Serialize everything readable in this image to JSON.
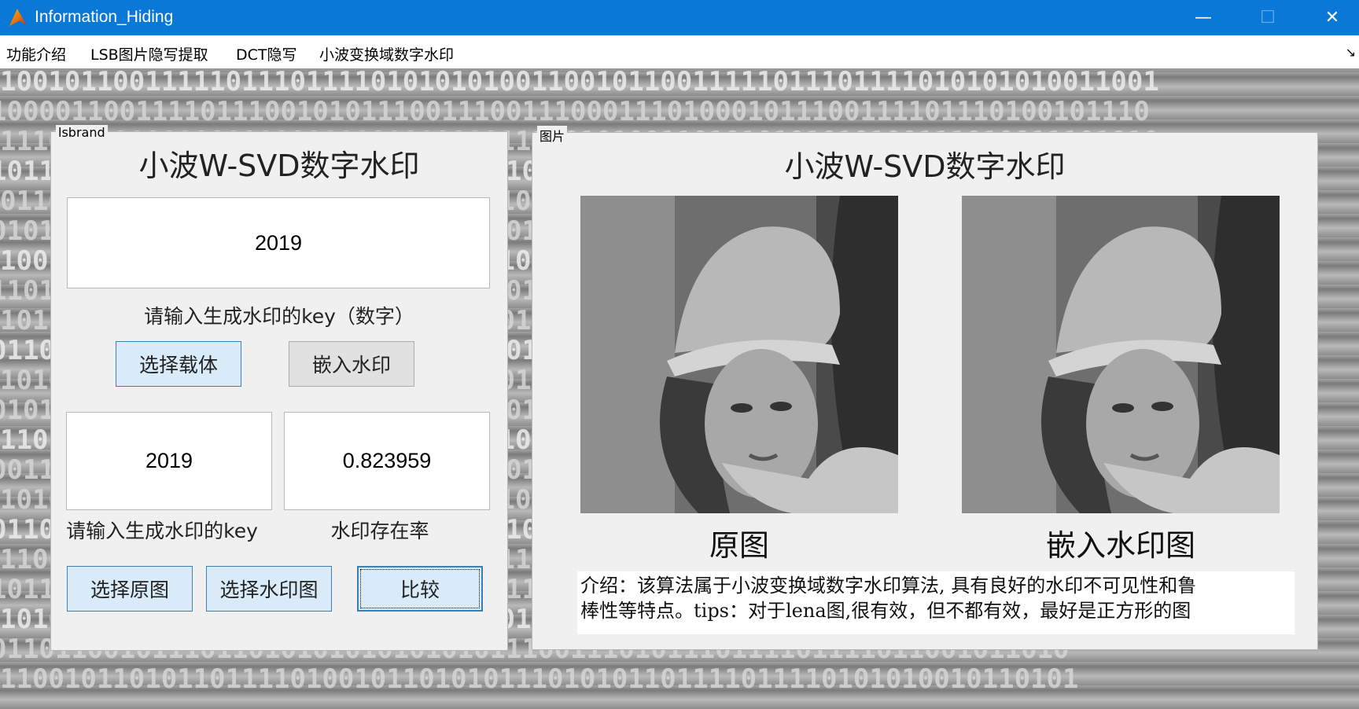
{
  "window": {
    "title": "Information_Hiding",
    "controls": {
      "minimize": "—",
      "maximize": "☐",
      "close": "✕"
    }
  },
  "menu": {
    "items": [
      "功能介绍",
      "LSB图片隐写提取",
      "DCT隐写",
      "小波变换域数字水印"
    ],
    "overflow_icon": "↘"
  },
  "background": {
    "binary_rows": [
      "100101100111110111011110101010100110010110011111011101111010101010011001",
      "100001100111101110010101110011100111000111010001011100111101110100101110",
      "111011101011001010011110101001011110101001101010101010100111010011101010",
      "10110011001101111000101101001110101101001011010110011010010111001101",
      "01101001011001101101011010110101001101100111010110010110101101101010",
      "01011010011010110010110110101011010100101101011001011010110101101011",
      "10010110110010101101001011011011010110101001010101101010110110010110",
      "11010011011010010110101100101011010101101011010101101011010100101101",
      "10110101001011010110101101010010110101011010110101001011010110101101",
      "01101011011010101001011010110101011010101101001010110101101010110101",
      "10101101001101011010101101011010100101101011010110101001011010110110",
      "01011010110101011010110100101101011010110101011010101101001011010101",
      "11010110101101010010110101101011010100101101011010110101011010101101",
      "00110101101011010110100101101011010101101011010010110101101010110100",
      "10101100101011010110101101001011010110101011010101101001011010110101",
      "01101011010110101001011010110101101010110100101101011010101101011010",
      "11001011010110101101010110100101101011010110101010110101101001010110",
      "10110101101001011010110101011010110101001011010110101101010110101001",
      "101011010110100010110110101010101100111100110111101011010101010101",
      "0110110010111011010101010101010111001110101110111101111011001011010",
      "1100101101011011110100101101010111010101101111011110101010010110101"
    ]
  },
  "left_panel": {
    "legend": "lsbrand",
    "heading": "小波W-SVD数字水印",
    "key_input_value": "2019",
    "key_input_label": "请输入生成水印的key（数字）",
    "btn_select_carrier": "选择载体",
    "btn_embed": "嵌入水印",
    "key2_value": "2019",
    "rate_value": "0.823959",
    "key2_label": "请输入生成水印的key",
    "rate_label": "水印存在率",
    "btn_select_original": "选择原图",
    "btn_select_watermark": "选择水印图",
    "btn_compare": "比较"
  },
  "right_panel": {
    "legend": "图片",
    "heading": "小波W-SVD数字水印",
    "caption_original": "原图",
    "caption_watermarked": "嵌入水印图",
    "intro_line1": "介绍：该算法属于小波变换域数字水印算法, 具有良好的水印不可见性和鲁",
    "intro_line2": "棒性等特点。tips：对于lena图,很有效，但不都有效，最好是正方形的图"
  }
}
